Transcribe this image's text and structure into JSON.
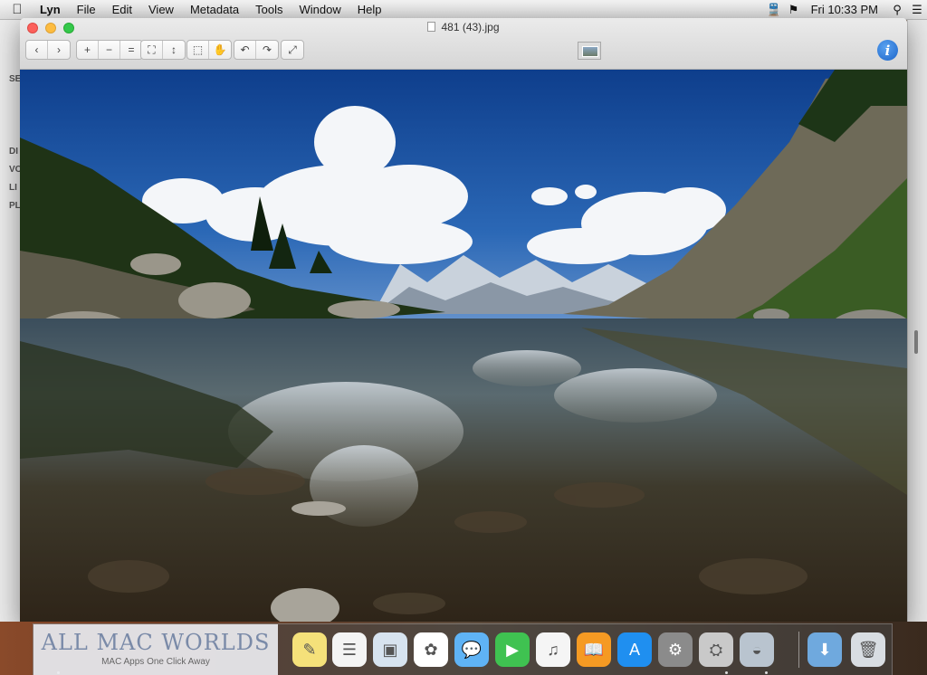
{
  "menubar": {
    "app_name": "Lyn",
    "items": [
      "File",
      "Edit",
      "View",
      "Metadata",
      "Tools",
      "Window",
      "Help"
    ],
    "clock": "Fri 10:33 PM",
    "status_icons": [
      "train-icon",
      "flag-icon",
      "search-icon",
      "list-icon"
    ]
  },
  "background_window": {
    "labels": [
      "SE",
      "DI",
      "VO",
      "LI",
      "PL"
    ]
  },
  "window": {
    "title": "481 (43).jpg",
    "toolbar": {
      "nav": [
        "‹",
        "›"
      ],
      "zoom": [
        "+",
        "−",
        "="
      ],
      "fit": [
        "⛶",
        "↕"
      ],
      "tools": [
        "⬚",
        "✋"
      ],
      "rotate": [
        "↶",
        "↷"
      ],
      "fullscreen": [
        "⤢"
      ]
    },
    "info_label": "i"
  },
  "dock": {
    "apps": [
      {
        "name": "notes",
        "glyph": "✎",
        "color": "#f5e17a"
      },
      {
        "name": "reminders",
        "glyph": "☰",
        "color": "#f4f4f4"
      },
      {
        "name": "preview",
        "glyph": "▣",
        "color": "#d7e3ef"
      },
      {
        "name": "photos",
        "glyph": "✿",
        "color": "#ffffff"
      },
      {
        "name": "messages",
        "glyph": "💬",
        "color": "#5fb3f5"
      },
      {
        "name": "facetime",
        "glyph": "▶",
        "color": "#3fc251"
      },
      {
        "name": "itunes",
        "glyph": "♫",
        "color": "#f5f5f5"
      },
      {
        "name": "ibooks",
        "glyph": "📖",
        "color": "#f59a23"
      },
      {
        "name": "app-store",
        "glyph": "A",
        "color": "#1f8ff0"
      },
      {
        "name": "system-preferences",
        "glyph": "⚙",
        "color": "#8b8b8b"
      },
      {
        "name": "disk-utility",
        "glyph": "⛭",
        "color": "#c9c9c9"
      },
      {
        "name": "hard-drive",
        "glyph": "◒",
        "color": "#b9c4cf"
      },
      {
        "name": "downloads",
        "glyph": "⬇",
        "color": "#6fa9de"
      },
      {
        "name": "trash",
        "glyph": "🗑",
        "color": "#d8dde2"
      }
    ]
  },
  "watermark": {
    "title": "ALL MAC WORLDS",
    "subtitle": "MAC Apps One Click Away"
  }
}
